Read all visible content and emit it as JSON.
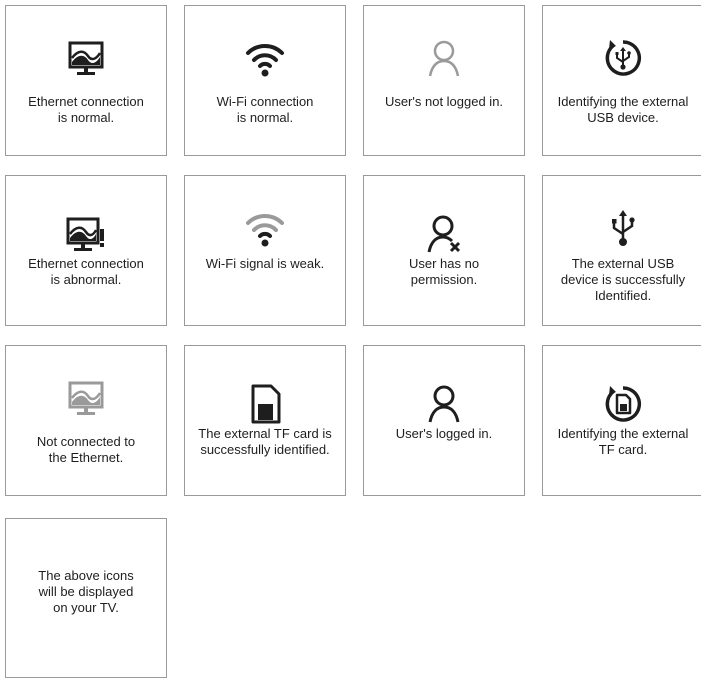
{
  "colors": {
    "icon_dark": "#1e1e1e",
    "icon_gray": "#9a9a9a",
    "border": "#9a9a9a"
  },
  "tiles": [
    {
      "icon": "monitor-wave-icon",
      "caption": "Ethernet connection\nis normal."
    },
    {
      "icon": "wifi-icon",
      "caption": "Wi-Fi connection\nis normal."
    },
    {
      "icon": "user-outline-icon",
      "caption": "User's not logged in."
    },
    {
      "icon": "usb-refresh-icon",
      "caption": "Identifying the external\nUSB device."
    },
    {
      "icon": "monitor-warning-icon",
      "caption": "Ethernet connection\nis abnormal."
    },
    {
      "icon": "wifi-weak-icon",
      "caption": "Wi-Fi signal is weak."
    },
    {
      "icon": "user-no-permission-icon",
      "caption": "User has no\npermission."
    },
    {
      "icon": "usb-icon",
      "caption": "The external USB\ndevice is successfully\nIdentified."
    },
    {
      "icon": "monitor-disconnected-icon",
      "caption": "Not connected to\nthe Ethernet."
    },
    {
      "icon": "sd-card-icon",
      "caption": "The external TF card is\nsuccessfully identified."
    },
    {
      "icon": "user-icon",
      "caption": "User's logged in."
    },
    {
      "icon": "sd-card-refresh-icon",
      "caption": "Identifying the external\nTF card."
    },
    {
      "icon": "",
      "caption": "The above icons\nwill be displayed\non your TV."
    }
  ]
}
